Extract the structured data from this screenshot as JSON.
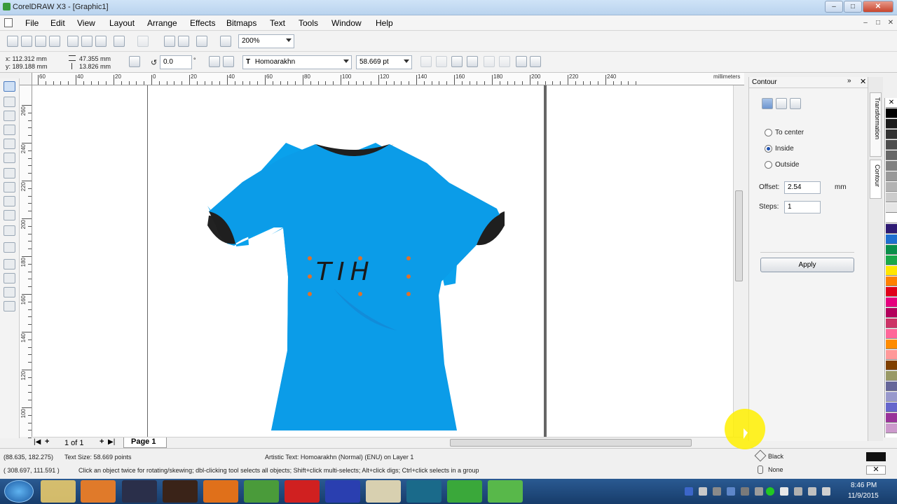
{
  "window": {
    "title": "CorelDRAW X3 - [Graphic1]",
    "min": "–",
    "max": "□",
    "close": "✕"
  },
  "menu": {
    "items": [
      "File",
      "Edit",
      "View",
      "Layout",
      "Arrange",
      "Effects",
      "Bitmaps",
      "Text",
      "Tools",
      "Window",
      "Help"
    ]
  },
  "toolbar": {
    "zoom_level": "200%"
  },
  "property_bar": {
    "x": "x: 112.312 mm",
    "y": "y: 189.188 mm",
    "width": "47.355 mm",
    "height": "13.826 mm",
    "rotation": "0.0",
    "degree": "°",
    "font_name": "Homoarakhn",
    "font_size": "58.669 pt"
  },
  "rulers": {
    "h_labels": [
      "60",
      "40",
      "20",
      "0",
      "20",
      "40",
      "60",
      "80",
      "100",
      "120",
      "140",
      "160",
      "180",
      "200",
      "220",
      "240"
    ],
    "h_unit": "millimeters",
    "v_labels": [
      "260",
      "240",
      "220",
      "200",
      "180",
      "160",
      "140",
      "120",
      "100"
    ]
  },
  "canvas": {
    "shirt_text": "TIH",
    "shirt_color": "#0a9ae6",
    "collar_color": "#222222"
  },
  "page_nav": {
    "page_count": "1 of 1",
    "tab_label": "Page 1"
  },
  "docker": {
    "title": "Contour",
    "options": [
      "To center",
      "Inside",
      "Outside"
    ],
    "selected_option": "Inside",
    "offset_label": "Offset:",
    "offset_value": "2.54",
    "offset_unit": "mm",
    "steps_label": "Steps:",
    "steps_value": "1",
    "apply_label": "Apply",
    "tabs": [
      "Transformation",
      "Contour"
    ]
  },
  "palette": {
    "colors": [
      "#ffffff",
      "#000000",
      "#1a1a1a",
      "#333333",
      "#4d4d4d",
      "#666666",
      "#808080",
      "#999999",
      "#b3b3b3",
      "#cccccc",
      "#e6e6e6",
      "#ffffff",
      "#2e1a73",
      "#1e6fcf",
      "#0a8f4a",
      "#1aa84a",
      "#ffe600",
      "#ff8000",
      "#e0001a",
      "#e6007e",
      "#b3005c",
      "#cc3366",
      "#ff6699",
      "#ff8c00",
      "#ff9999",
      "#7f3f00",
      "#999966",
      "#666699",
      "#9999cc",
      "#6666cc",
      "#993399",
      "#cc99cc"
    ]
  },
  "status": {
    "coords1": "(88.635, 182.275)",
    "text_size": "Text Size: 58.669 points",
    "object_info": "Artistic Text: Homoarakhn (Normal) (ENU) on Layer 1",
    "coords2": "( 308.697, 111.591 )",
    "hint": "Click an object twice for rotating/skewing; dbl-clicking tool selects all objects; Shift+click multi-selects; Alt+click digs; Ctrl+click selects in a group",
    "fill_label": "Black",
    "outline_label": "None"
  },
  "taskbar": {
    "time": "8:46 PM",
    "date": "11/9/2015",
    "apps": [
      "explorer",
      "media-player",
      "after-effects",
      "illustrator",
      "firefox",
      "chrome",
      "opera",
      "m-app",
      "r-app",
      "e-app",
      "coreldraw",
      "corel-capture"
    ]
  }
}
